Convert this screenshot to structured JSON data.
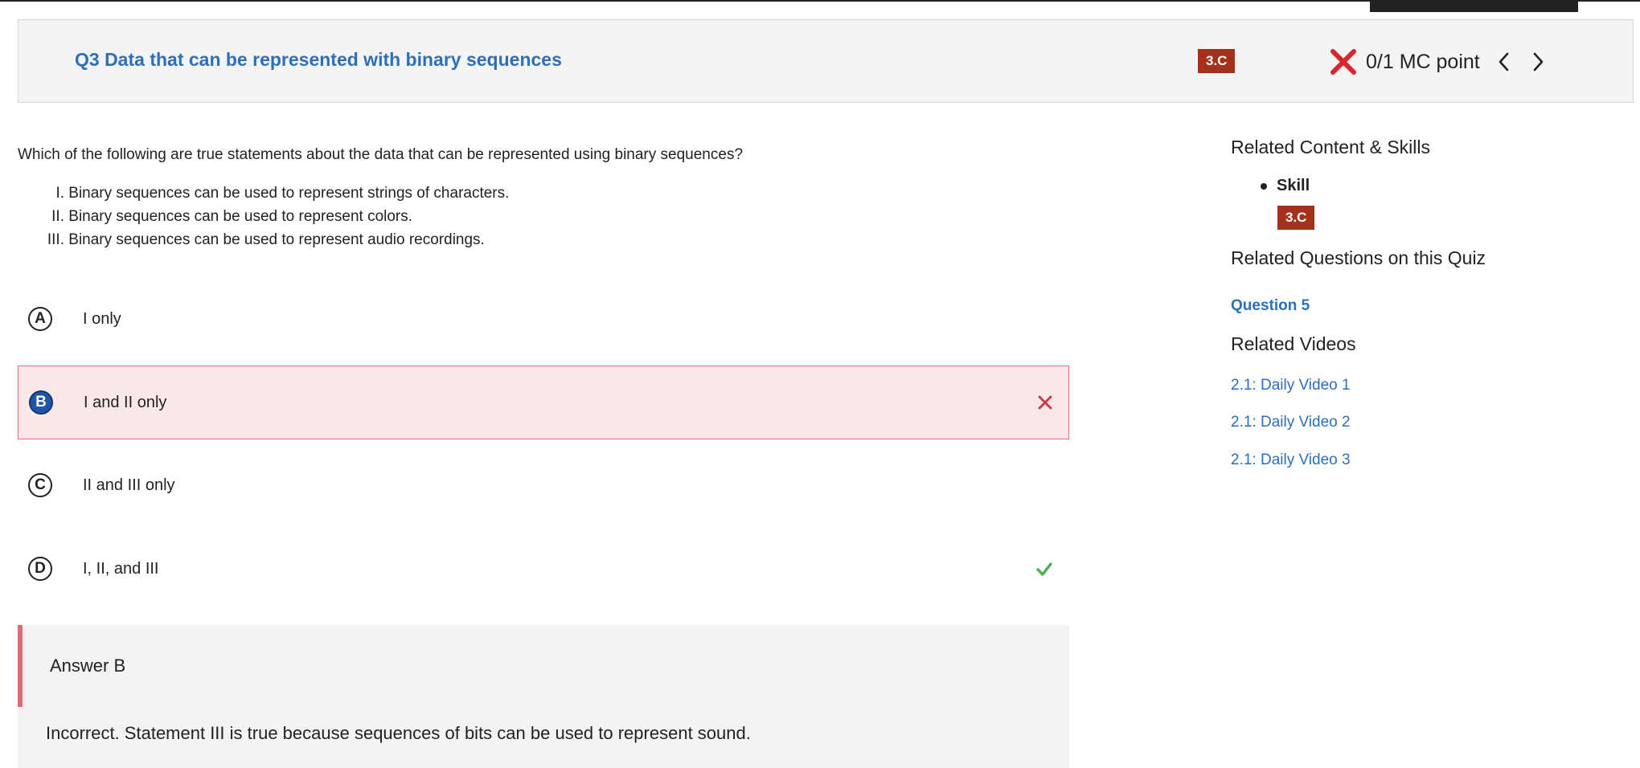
{
  "header": {
    "title": "Q3 Data that can be represented with binary sequences",
    "skill_badge": "3.C",
    "score": "0/1 MC point",
    "status_color": "#d7282f"
  },
  "question": {
    "prompt": "Which of the following are true statements about the data that can be represented using binary sequences?",
    "statements": [
      {
        "num": "I.",
        "text": "Binary sequences can be used to represent strings of characters."
      },
      {
        "num": "II.",
        "text": "Binary sequences can be used to represent colors."
      },
      {
        "num": "III.",
        "text": "Binary sequences can be used to represent audio recordings."
      }
    ]
  },
  "choices": [
    {
      "letter": "A",
      "text": "I only"
    },
    {
      "letter": "B",
      "text": "I and II only",
      "selected": true,
      "mark": "x-icon"
    },
    {
      "letter": "C",
      "text": "II and III only"
    },
    {
      "letter": "D",
      "text": "I, II, and III",
      "mark": "check-icon"
    }
  ],
  "feedback": {
    "answer_label": "Answer B",
    "explanation": "Incorrect. Statement III is true because sequences of bits can be used to represent sound."
  },
  "sidebar": {
    "related_content_heading": "Related Content & Skills",
    "skill_label": "Skill",
    "skill_badge": "3.C",
    "related_questions_heading": "Related Questions on this Quiz",
    "related_questions": [
      "Question 5"
    ],
    "related_videos_heading": "Related Videos",
    "related_videos": [
      "2.1: Daily Video 1",
      "2.1: Daily Video 2",
      "2.1: Daily Video 3"
    ]
  },
  "colors": {
    "link": "#2c6fbb",
    "badge": "#a3321c",
    "wrong_bg": "#f8e8e8",
    "wrong_border": "#e0707c",
    "correct": "#4caf50"
  }
}
